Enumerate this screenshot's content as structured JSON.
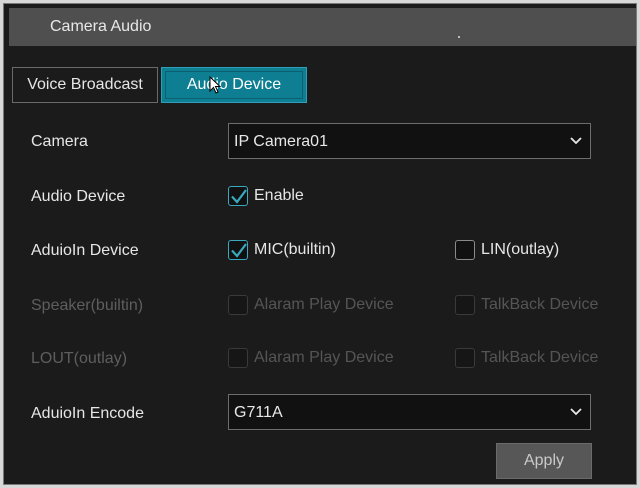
{
  "window": {
    "title": "Camera Audio"
  },
  "tabs": [
    {
      "label": "Voice Broadcast",
      "active": false
    },
    {
      "label": "Audio Device",
      "active": true
    }
  ],
  "form": {
    "camera": {
      "label": "Camera",
      "value": "IP Camera01"
    },
    "audio_device": {
      "label": "Audio Device",
      "enable_label": "Enable",
      "enabled": true
    },
    "audioin_device": {
      "label": "AduioIn Device",
      "options": [
        {
          "label": "MIC(builtin)",
          "checked": true
        },
        {
          "label": "LIN(outlay)",
          "checked": false
        }
      ]
    },
    "speaker_builtin": {
      "label": "Speaker(builtin)",
      "options": [
        {
          "label": "Alaram Play Device",
          "checked": false,
          "disabled": true
        },
        {
          "label": "TalkBack Device",
          "checked": false,
          "disabled": true
        }
      ]
    },
    "lout_outlay": {
      "label": "LOUT(outlay)",
      "options": [
        {
          "label": "Alaram Play Device",
          "checked": false,
          "disabled": true
        },
        {
          "label": "TalkBack Device",
          "checked": false,
          "disabled": true
        }
      ]
    },
    "audioin_encode": {
      "label": "AduioIn Encode",
      "value": "G711A"
    }
  },
  "buttons": {
    "apply": "Apply"
  },
  "colors": {
    "accent": "#0e7f93",
    "check": "#3aa8bf",
    "background": "#1b1b1b",
    "titlebar": "#4f4f4f"
  }
}
